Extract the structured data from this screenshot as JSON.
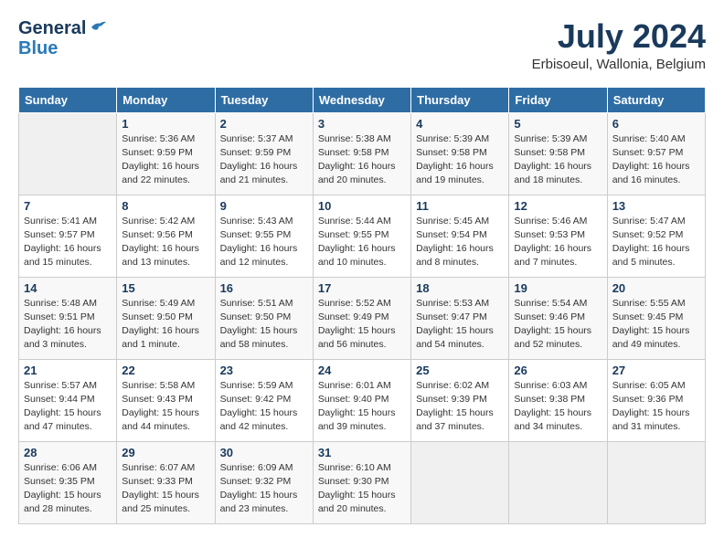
{
  "header": {
    "logo_general": "General",
    "logo_blue": "Blue",
    "month_year": "July 2024",
    "location": "Erbisoeul, Wallonia, Belgium"
  },
  "columns": [
    "Sunday",
    "Monday",
    "Tuesday",
    "Wednesday",
    "Thursday",
    "Friday",
    "Saturday"
  ],
  "weeks": [
    [
      {
        "day": "",
        "info": ""
      },
      {
        "day": "1",
        "info": "Sunrise: 5:36 AM\nSunset: 9:59 PM\nDaylight: 16 hours\nand 22 minutes."
      },
      {
        "day": "2",
        "info": "Sunrise: 5:37 AM\nSunset: 9:59 PM\nDaylight: 16 hours\nand 21 minutes."
      },
      {
        "day": "3",
        "info": "Sunrise: 5:38 AM\nSunset: 9:58 PM\nDaylight: 16 hours\nand 20 minutes."
      },
      {
        "day": "4",
        "info": "Sunrise: 5:39 AM\nSunset: 9:58 PM\nDaylight: 16 hours\nand 19 minutes."
      },
      {
        "day": "5",
        "info": "Sunrise: 5:39 AM\nSunset: 9:58 PM\nDaylight: 16 hours\nand 18 minutes."
      },
      {
        "day": "6",
        "info": "Sunrise: 5:40 AM\nSunset: 9:57 PM\nDaylight: 16 hours\nand 16 minutes."
      }
    ],
    [
      {
        "day": "7",
        "info": "Sunrise: 5:41 AM\nSunset: 9:57 PM\nDaylight: 16 hours\nand 15 minutes."
      },
      {
        "day": "8",
        "info": "Sunrise: 5:42 AM\nSunset: 9:56 PM\nDaylight: 16 hours\nand 13 minutes."
      },
      {
        "day": "9",
        "info": "Sunrise: 5:43 AM\nSunset: 9:55 PM\nDaylight: 16 hours\nand 12 minutes."
      },
      {
        "day": "10",
        "info": "Sunrise: 5:44 AM\nSunset: 9:55 PM\nDaylight: 16 hours\nand 10 minutes."
      },
      {
        "day": "11",
        "info": "Sunrise: 5:45 AM\nSunset: 9:54 PM\nDaylight: 16 hours\nand 8 minutes."
      },
      {
        "day": "12",
        "info": "Sunrise: 5:46 AM\nSunset: 9:53 PM\nDaylight: 16 hours\nand 7 minutes."
      },
      {
        "day": "13",
        "info": "Sunrise: 5:47 AM\nSunset: 9:52 PM\nDaylight: 16 hours\nand 5 minutes."
      }
    ],
    [
      {
        "day": "14",
        "info": "Sunrise: 5:48 AM\nSunset: 9:51 PM\nDaylight: 16 hours\nand 3 minutes."
      },
      {
        "day": "15",
        "info": "Sunrise: 5:49 AM\nSunset: 9:50 PM\nDaylight: 16 hours\nand 1 minute."
      },
      {
        "day": "16",
        "info": "Sunrise: 5:51 AM\nSunset: 9:50 PM\nDaylight: 15 hours\nand 58 minutes."
      },
      {
        "day": "17",
        "info": "Sunrise: 5:52 AM\nSunset: 9:49 PM\nDaylight: 15 hours\nand 56 minutes."
      },
      {
        "day": "18",
        "info": "Sunrise: 5:53 AM\nSunset: 9:47 PM\nDaylight: 15 hours\nand 54 minutes."
      },
      {
        "day": "19",
        "info": "Sunrise: 5:54 AM\nSunset: 9:46 PM\nDaylight: 15 hours\nand 52 minutes."
      },
      {
        "day": "20",
        "info": "Sunrise: 5:55 AM\nSunset: 9:45 PM\nDaylight: 15 hours\nand 49 minutes."
      }
    ],
    [
      {
        "day": "21",
        "info": "Sunrise: 5:57 AM\nSunset: 9:44 PM\nDaylight: 15 hours\nand 47 minutes."
      },
      {
        "day": "22",
        "info": "Sunrise: 5:58 AM\nSunset: 9:43 PM\nDaylight: 15 hours\nand 44 minutes."
      },
      {
        "day": "23",
        "info": "Sunrise: 5:59 AM\nSunset: 9:42 PM\nDaylight: 15 hours\nand 42 minutes."
      },
      {
        "day": "24",
        "info": "Sunrise: 6:01 AM\nSunset: 9:40 PM\nDaylight: 15 hours\nand 39 minutes."
      },
      {
        "day": "25",
        "info": "Sunrise: 6:02 AM\nSunset: 9:39 PM\nDaylight: 15 hours\nand 37 minutes."
      },
      {
        "day": "26",
        "info": "Sunrise: 6:03 AM\nSunset: 9:38 PM\nDaylight: 15 hours\nand 34 minutes."
      },
      {
        "day": "27",
        "info": "Sunrise: 6:05 AM\nSunset: 9:36 PM\nDaylight: 15 hours\nand 31 minutes."
      }
    ],
    [
      {
        "day": "28",
        "info": "Sunrise: 6:06 AM\nSunset: 9:35 PM\nDaylight: 15 hours\nand 28 minutes."
      },
      {
        "day": "29",
        "info": "Sunrise: 6:07 AM\nSunset: 9:33 PM\nDaylight: 15 hours\nand 25 minutes."
      },
      {
        "day": "30",
        "info": "Sunrise: 6:09 AM\nSunset: 9:32 PM\nDaylight: 15 hours\nand 23 minutes."
      },
      {
        "day": "31",
        "info": "Sunrise: 6:10 AM\nSunset: 9:30 PM\nDaylight: 15 hours\nand 20 minutes."
      },
      {
        "day": "",
        "info": ""
      },
      {
        "day": "",
        "info": ""
      },
      {
        "day": "",
        "info": ""
      }
    ]
  ]
}
